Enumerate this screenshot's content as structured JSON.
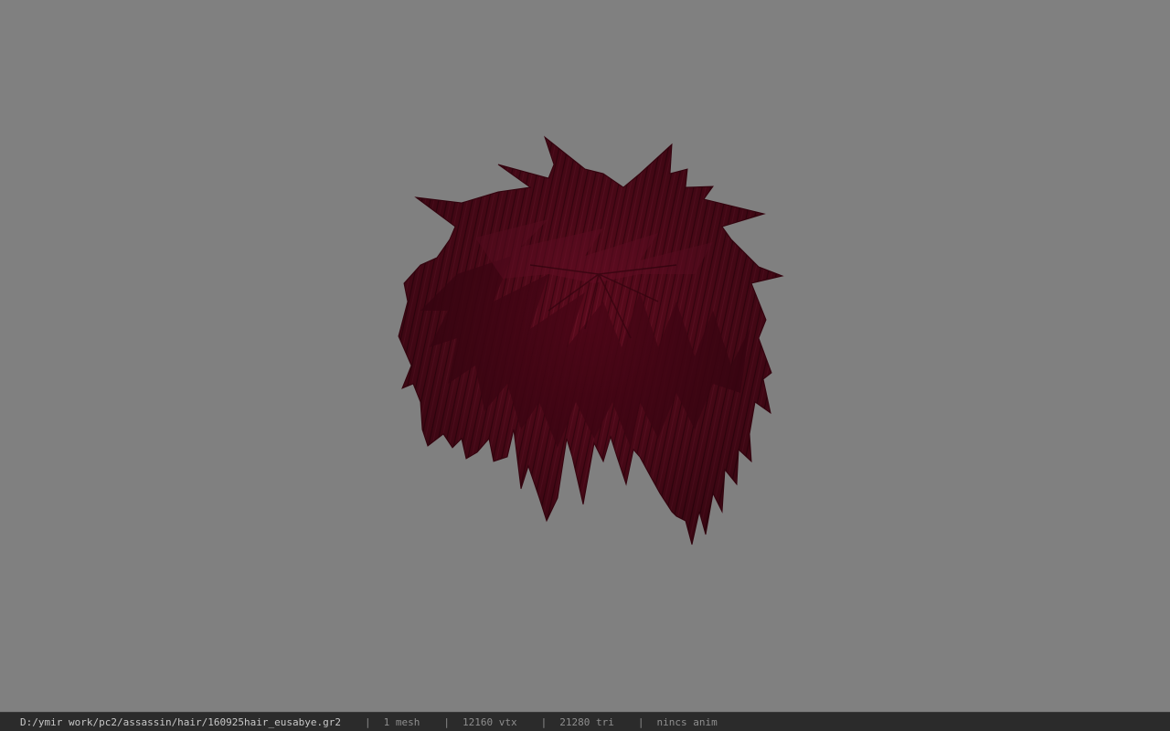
{
  "viewport": {
    "background": "#808080",
    "model": {
      "name": "hair-mesh",
      "color": "#5a0a1c"
    }
  },
  "statusbar": {
    "path": "D:/ymir work/pc2/assassin/hair/160925hair_eusabye.gr2",
    "separator": "|",
    "mesh_count": "1 mesh",
    "vertex_count": "12160 vtx",
    "triangle_count": "21280 tri",
    "anim_status": "nincs anim"
  }
}
